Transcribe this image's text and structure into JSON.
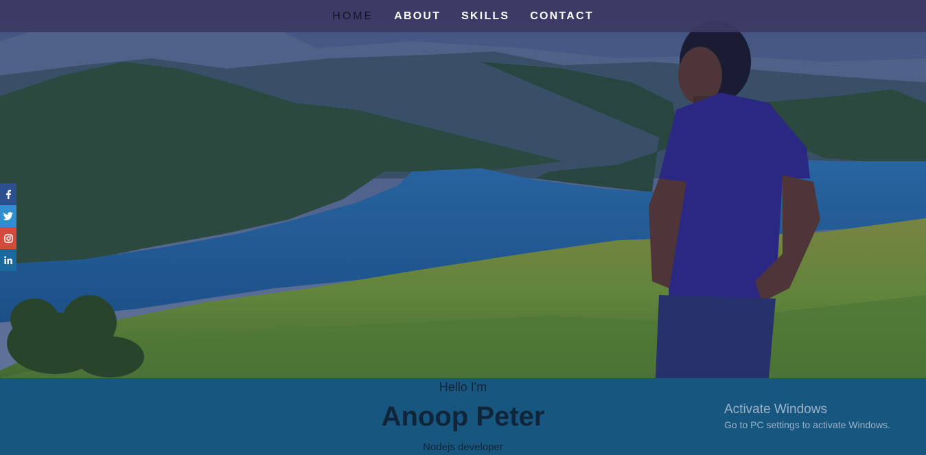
{
  "nav": {
    "items": [
      {
        "label": "HOME",
        "active": true
      },
      {
        "label": "ABOUT",
        "active": false
      },
      {
        "label": "SKILLS",
        "active": false
      },
      {
        "label": "CONTACT",
        "active": false
      }
    ]
  },
  "social": {
    "icons": [
      "facebook-icon",
      "twitter-icon",
      "instagram-icon",
      "linkedin-icon"
    ],
    "colors": {
      "facebook": "#2d4f8f",
      "twitter": "#2f8fd0",
      "instagram": "#d34b3d",
      "linkedin": "#1a6aa0"
    }
  },
  "intro": {
    "greeting": "Hello I'm",
    "name": "Anoop Peter",
    "role": "Nodejs developer"
  },
  "watermark": {
    "title": "Activate Windows",
    "subtitle": "Go to PC settings to activate Windows."
  },
  "colors": {
    "nav_background": "#3c3a64",
    "section_background": "#17577f",
    "text_dark": "#10243a"
  }
}
